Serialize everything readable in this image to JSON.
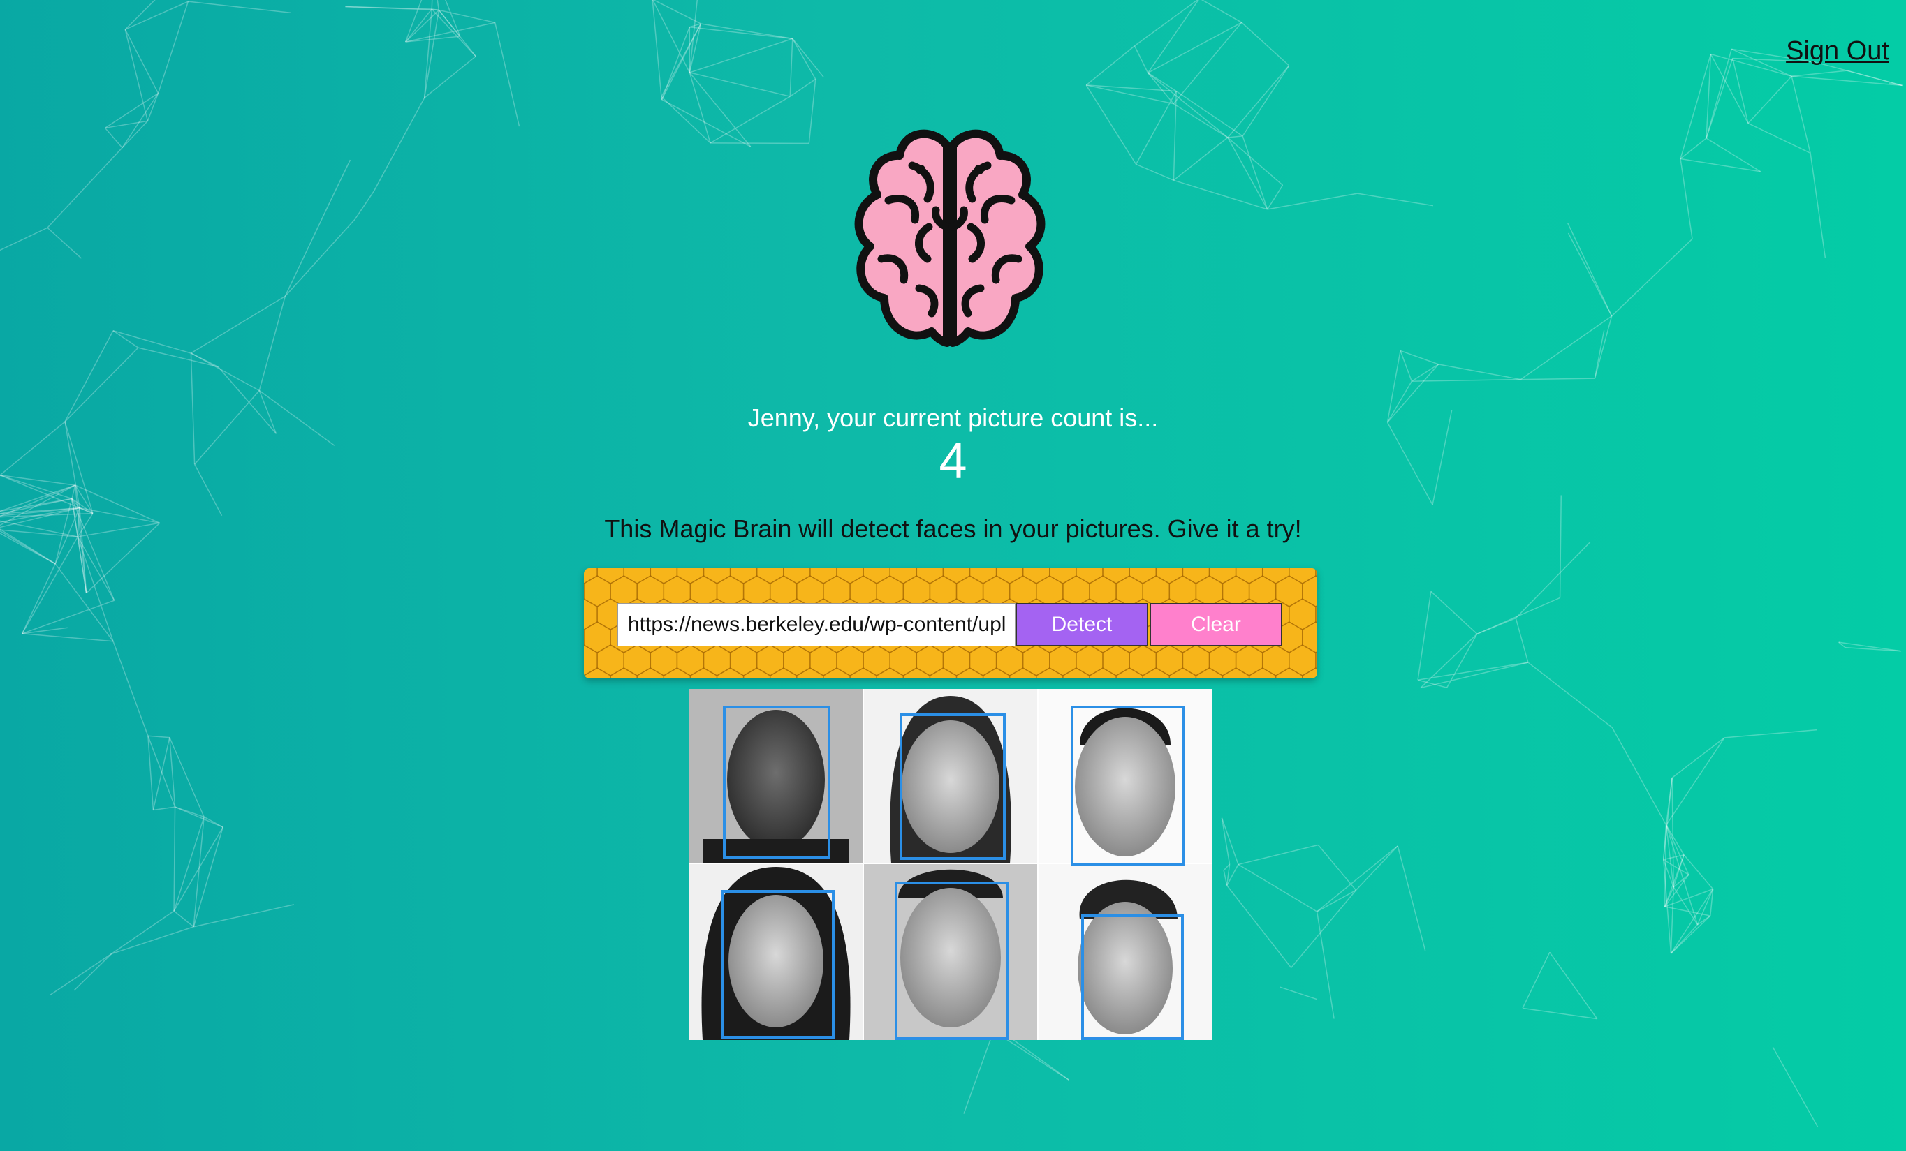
{
  "nav": {
    "sign_out_label": "Sign Out"
  },
  "logo": {
    "icon": "brain-icon",
    "color": "#f9a7c3"
  },
  "rank": {
    "message": "Jenny, your current picture count is...",
    "count": "4"
  },
  "intro": {
    "text": "This Magic Brain will detect faces in your pictures. Give it a try!"
  },
  "image_form": {
    "input_value": "https://news.berkeley.edu/wp-content/upl",
    "detect_label": "Detect",
    "clear_label": "Clear",
    "panel_color": "#f7b51a",
    "detect_color": "#a463f2",
    "clear_color": "#ff80cc"
  },
  "face_recognition": {
    "face_box_color": "#2b8fe6",
    "detected_face_count": 6
  }
}
